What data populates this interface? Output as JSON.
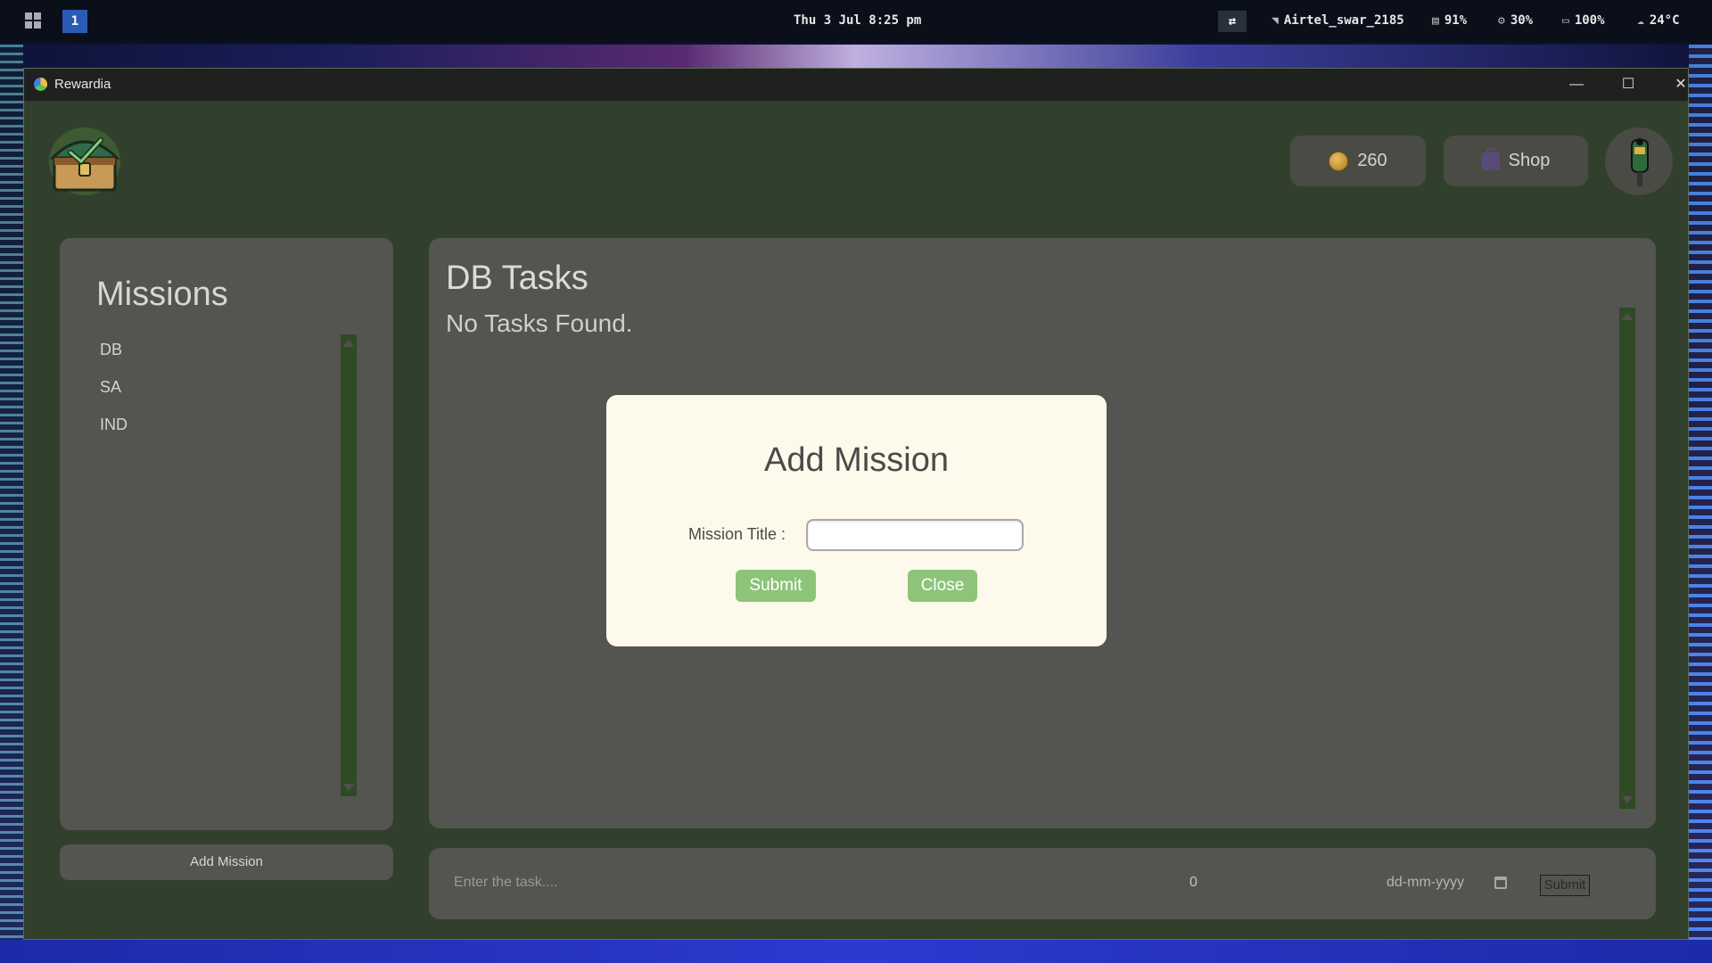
{
  "taskbar": {
    "workspace": "1",
    "clock": "Thu 3 Jul 8:25 pm",
    "wifi": "Airtel_swar_2185",
    "memory": "91%",
    "cpu": "30%",
    "battery": "100%",
    "weather": "24°C"
  },
  "window": {
    "title": "Rewardia",
    "minimize": "—",
    "maximize": "☐",
    "close": "✕"
  },
  "header": {
    "coins": "260",
    "shop_label": "Shop"
  },
  "sidebar": {
    "title": "Missions",
    "items": [
      {
        "label": "DB"
      },
      {
        "label": "SA"
      },
      {
        "label": "IND"
      }
    ],
    "add_button": "Add Mission"
  },
  "main": {
    "title": "DB Tasks",
    "empty_message": "No Tasks Found."
  },
  "task_form": {
    "placeholder": "Enter the task....",
    "points": "0",
    "date_placeholder": "dd-mm-yyyy",
    "submit_label": "Submit"
  },
  "modal": {
    "title": "Add Mission",
    "field_label": "Mission Title :",
    "field_value": "",
    "submit_label": "Submit",
    "close_label": "Close"
  },
  "colors": {
    "app_bg": "#31402c",
    "panel": "#545450",
    "modal_bg": "#fdfaeb",
    "modal_button": "#8ec37a",
    "scrollbar": "#2f4a25"
  }
}
